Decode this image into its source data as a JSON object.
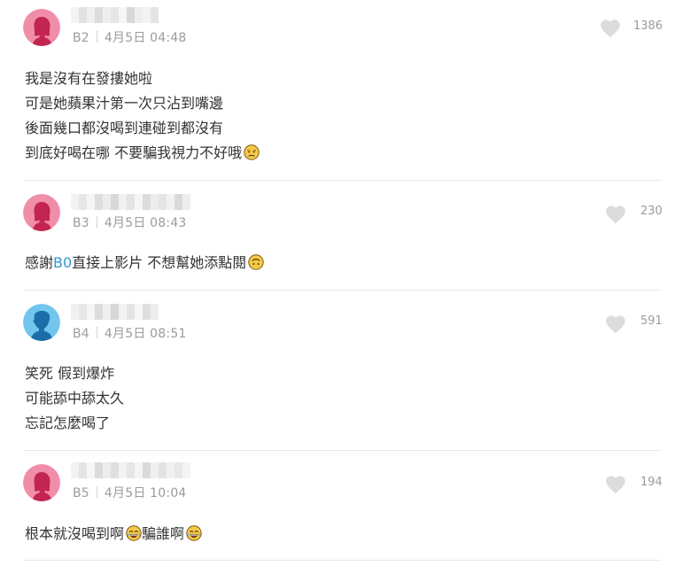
{
  "comments": [
    {
      "floor": "B2",
      "date": "4月5日 04:48",
      "likes": "1386",
      "avatar": "female-avatar-icon",
      "avatar_color": "#f08da9",
      "lines": [
        "我是沒有在發摟她啦",
        "可是她蘋果汁第一次只沾到嘴邊",
        "後面幾口都沒喝到連碰到都沒有",
        "到底好喝在哪 不要騙我視力不好哦"
      ],
      "emoji": "disappointed-face-icon"
    },
    {
      "floor": "B3",
      "date": "4月5日 08:43",
      "likes": "230",
      "avatar": "female-avatar-icon",
      "avatar_color": "#f08da9",
      "text_before": "感謝",
      "mention": "B0",
      "text_after": "直接上影片 不想幫她添點閱",
      "emoji": "upside-down-face-icon"
    },
    {
      "floor": "B4",
      "date": "4月5日 08:51",
      "likes": "591",
      "avatar": "male-avatar-icon",
      "avatar_color": "#72c6ee",
      "lines": [
        "笑死 假到爆炸",
        "可能舔中舔太久",
        "忘記怎麼喝了"
      ]
    },
    {
      "floor": "B5",
      "date": "4月5日 10:04",
      "likes": "194",
      "avatar": "female-avatar-icon",
      "avatar_color": "#f08da9",
      "text_before": "根本就沒喝到啊",
      "text_after": "騙誰啊",
      "emoji": "tears-of-joy-icon"
    }
  ],
  "colors": {
    "text": "#333333",
    "meta": "#9b9b9b",
    "heart": "#dcdcdc",
    "mention": "#3397cf",
    "divider": "#e9e9e9"
  }
}
